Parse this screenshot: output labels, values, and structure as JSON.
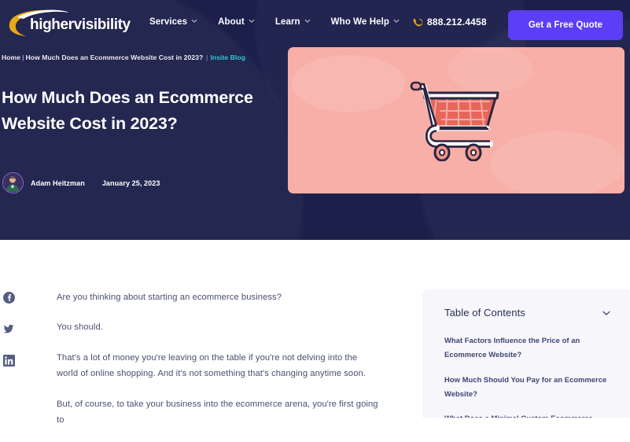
{
  "brand": {
    "name": "highervisibility",
    "logo_icon": "highervisibility-logo"
  },
  "nav": {
    "items": [
      {
        "label": "Services",
        "has_dropdown": true,
        "icon": "chevron-down-icon"
      },
      {
        "label": "About",
        "has_dropdown": true,
        "icon": "chevron-down-icon"
      },
      {
        "label": "Learn",
        "has_dropdown": true,
        "icon": "chevron-down-icon"
      },
      {
        "label": "Who We Help",
        "has_dropdown": true,
        "icon": "chevron-down-icon"
      }
    ],
    "phone": {
      "icon": "phone-icon",
      "number": "888.212.4458"
    },
    "cta": {
      "label": "Get a Free Quote",
      "color": "#5b3ef5"
    }
  },
  "breadcrumb": {
    "home": "Home",
    "separator": "|",
    "current": "How Much Does an Ecommerce Website Cost in 2023?",
    "right_separator": "|",
    "right_link": "Insite Blog",
    "right_link_color": "#2fc8d4"
  },
  "hero": {
    "title": "How Much Does an Ecommerce Website Cost in 2023?",
    "author": "Adam Heitzman",
    "date": "January 25, 2023",
    "avatar_icon": "author-avatar",
    "image_icon": "shopping-cart-illustration",
    "image_bg": "#f7afa8",
    "background": "#1c1f4a"
  },
  "share": {
    "items": [
      {
        "icon": "facebook-icon",
        "label": "Facebook"
      },
      {
        "icon": "twitter-icon",
        "label": "Twitter"
      },
      {
        "icon": "linkedin-icon",
        "label": "LinkedIn"
      }
    ]
  },
  "article": {
    "paragraphs": [
      "Are you thinking about starting an ecommerce business?",
      "You should.",
      "That's a lot of money you're leaving on the table if you're not delving into the world of online shopping. And it's not something that's changing anytime soon.",
      "But, of course, to take your business into the ecommerce arena, you're first going to"
    ]
  },
  "toc": {
    "title": "Table of Contents",
    "toggle_icon": "chevron-down-icon",
    "links": [
      "What Factors Influence the Price of an Ecommerce Website?",
      "How Much Should You Pay for an Ecommerce Website?",
      "What Does a Minimal Custom Ecommerce Website"
    ]
  }
}
